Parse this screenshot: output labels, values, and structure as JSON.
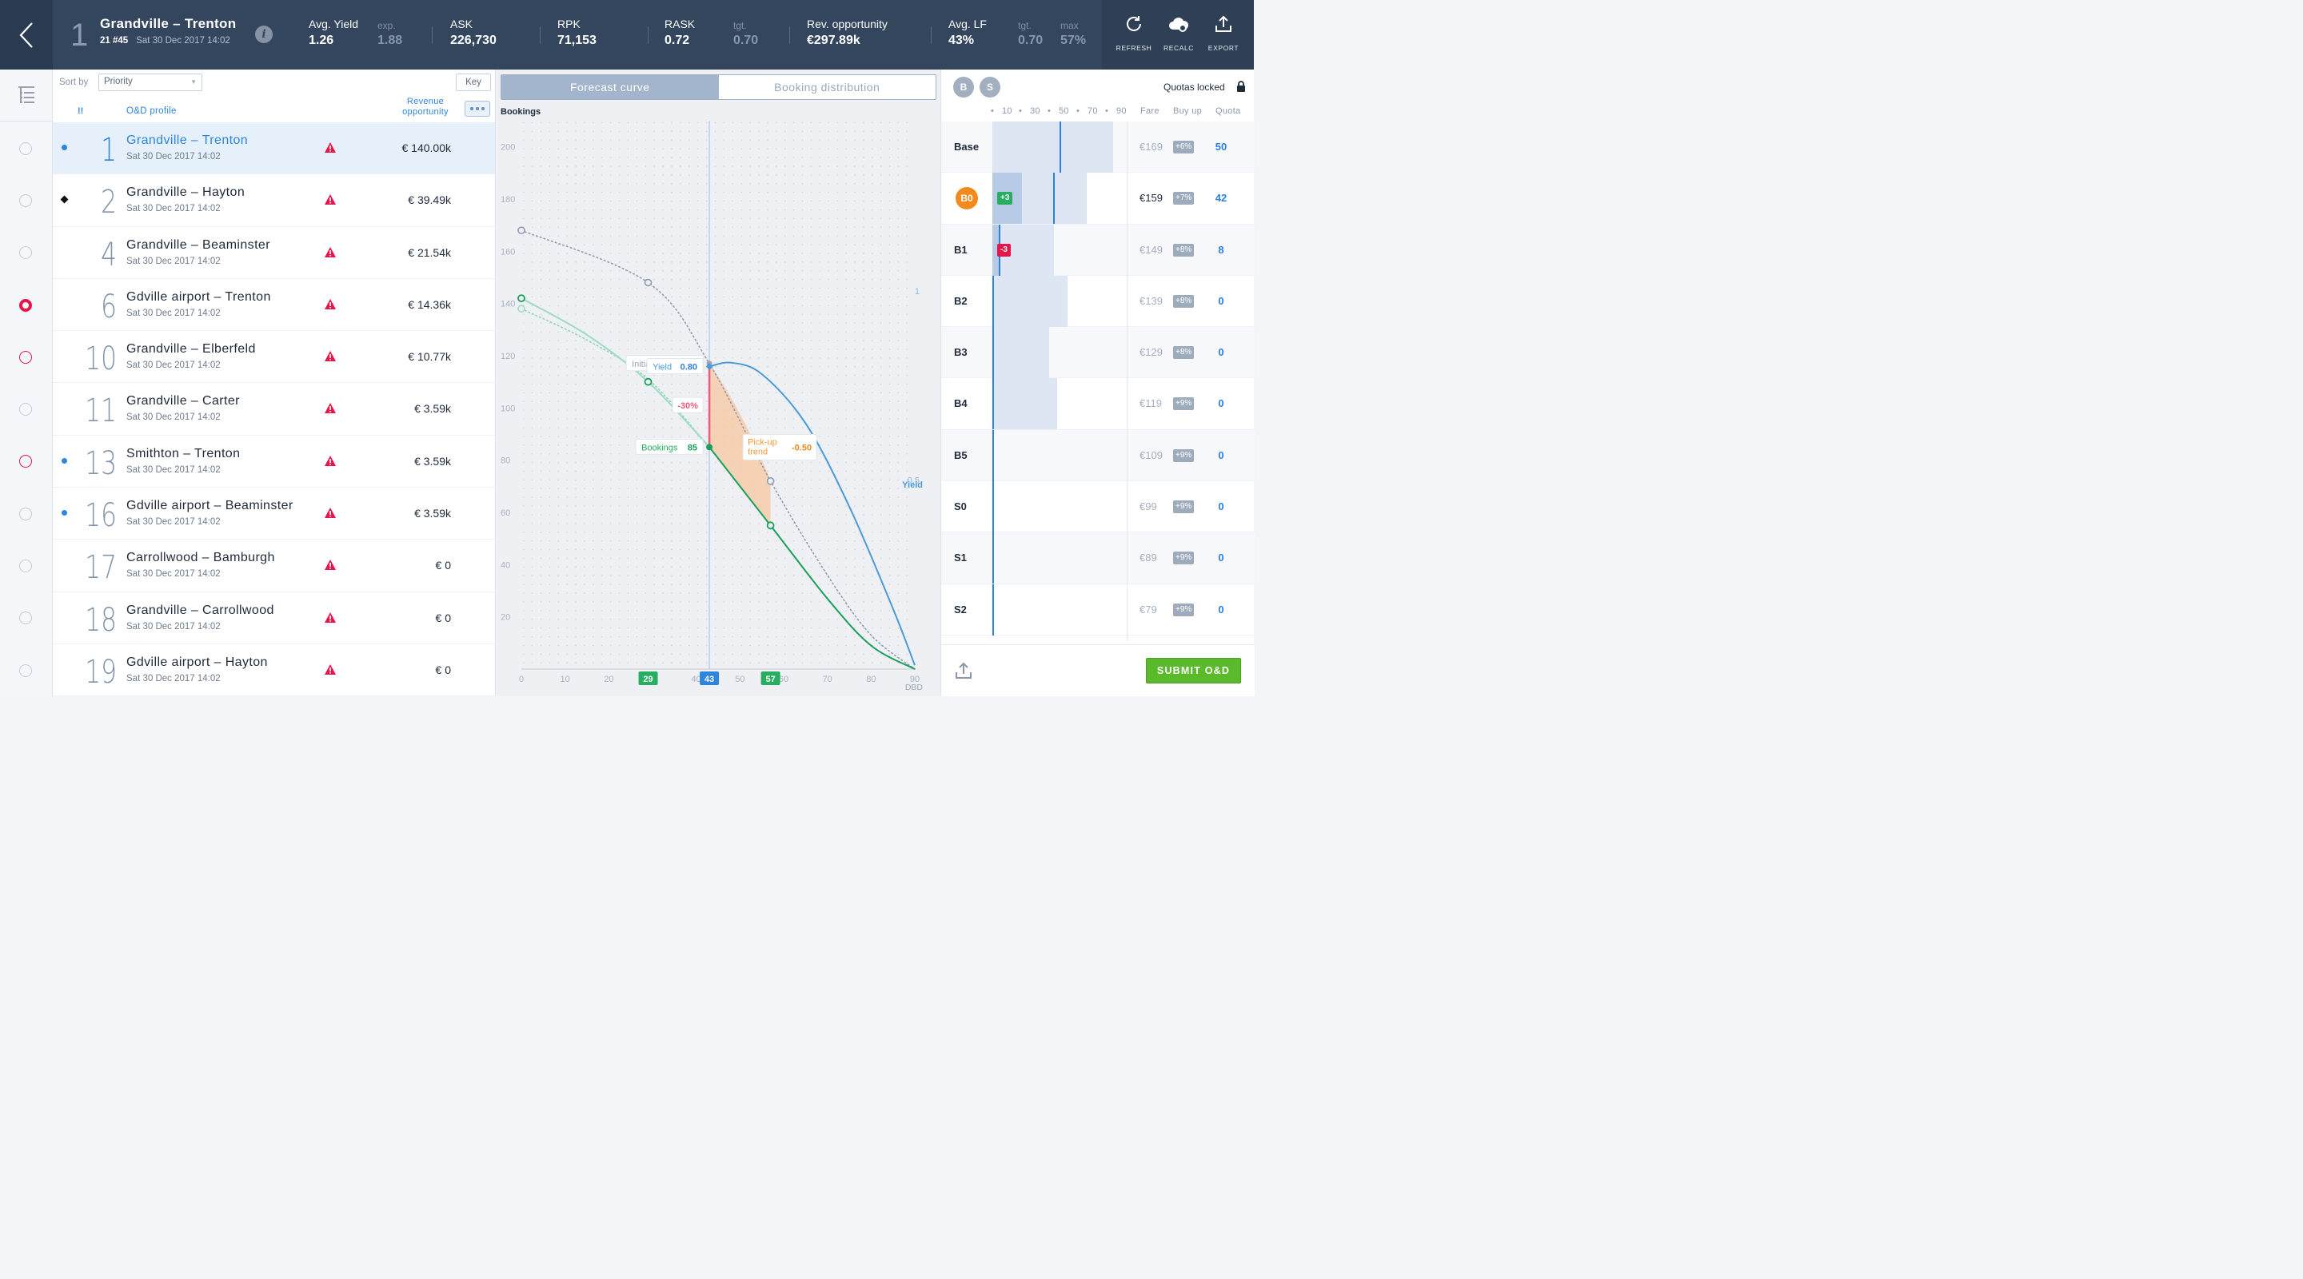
{
  "header": {
    "route_number": "1",
    "route_name": "Grandville – Trenton",
    "flight_code": "21 #45",
    "departure": "Sat 30 Dec 2017 14:02",
    "kpis": [
      {
        "label": "Avg. Yield",
        "value": "1.26",
        "sub_label": "exp.",
        "sub_value": "1.88"
      },
      {
        "label": "ASK",
        "value": "226,730"
      },
      {
        "label": "RPK",
        "value": "71,153"
      },
      {
        "label": "RASK",
        "value": "0.72",
        "sub_label": "tgt.",
        "sub_value": "0.70"
      },
      {
        "label": "Rev. opportunity",
        "value": "€297.89k"
      },
      {
        "label": "Avg. LF",
        "value": "43%",
        "sub_label": "tgt.",
        "sub_value": "0.70",
        "sub_label2": "max",
        "sub_value2": "57%"
      }
    ],
    "actions": [
      {
        "label": "REFRESH",
        "icon": "refresh-icon"
      },
      {
        "label": "RECALC",
        "icon": "cloud-gear-icon"
      },
      {
        "label": "EXPORT",
        "icon": "export-icon"
      }
    ]
  },
  "list": {
    "sort_by_label": "Sort by",
    "sort_by_value": "Priority",
    "key_label": "Key",
    "col_priority": "!!",
    "col_profile": "O&D profile",
    "col_revenue": "Revenue opportunity",
    "rows": [
      {
        "num": "1",
        "name": "Grandville – Trenton",
        "date": "Sat 30 Dec 2017 14:02",
        "rev": "€ 140.00k",
        "marker": "dot",
        "radio": "empty",
        "active": true
      },
      {
        "num": "2",
        "name": "Grandville – Hayton",
        "date": "Sat 30 Dec 2017 14:02",
        "rev": "€ 39.49k",
        "marker": "diamond",
        "radio": "empty"
      },
      {
        "num": "4",
        "name": "Grandville – Beaminster",
        "date": "Sat 30 Dec 2017 14:02",
        "rev": "€ 21.54k",
        "marker": "",
        "radio": "empty"
      },
      {
        "num": "6",
        "name": "Gdville airport – Trenton",
        "date": "Sat 30 Dec 2017 14:02",
        "rev": "€ 14.36k",
        "marker": "",
        "radio": "selected"
      },
      {
        "num": "10",
        "name": "Grandville – Elberfeld",
        "date": "Sat 30 Dec 2017 14:02",
        "rev": "€ 10.77k",
        "marker": "",
        "radio": "red"
      },
      {
        "num": "11",
        "name": "Grandville – Carter",
        "date": "Sat 30 Dec 2017 14:02",
        "rev": "€ 3.59k",
        "marker": "",
        "radio": "empty"
      },
      {
        "num": "13",
        "name": "Smithton – Trenton",
        "date": "Sat 30 Dec 2017 14:02",
        "rev": "€ 3.59k",
        "marker": "dot",
        "radio": "red"
      },
      {
        "num": "16",
        "name": "Gdville airport – Beaminster",
        "date": "Sat 30 Dec 2017 14:02",
        "rev": "€ 3.59k",
        "marker": "dot",
        "radio": "empty"
      },
      {
        "num": "17",
        "name": "Carrollwood – Bamburgh",
        "date": "Sat 30 Dec 2017 14:02",
        "rev": "€ 0",
        "marker": "",
        "radio": "empty"
      },
      {
        "num": "18",
        "name": "Grandville – Carrollwood",
        "date": "Sat 30 Dec 2017 14:02",
        "rev": "€ 0",
        "marker": "",
        "radio": "empty"
      },
      {
        "num": "19",
        "name": "Gdville airport – Hayton",
        "date": "Sat 30 Dec 2017 14:02",
        "rev": "€ 0",
        "marker": "",
        "radio": "empty"
      }
    ]
  },
  "chart_tabs": [
    {
      "label": "Forecast curve",
      "active": true
    },
    {
      "label": "Booking distribution",
      "active": false
    }
  ],
  "chart_data": {
    "type": "line",
    "ylabel": "Bookings",
    "xlabel": "DBD",
    "y2label": "Yield",
    "xlim": [
      0,
      90
    ],
    "ylim": [
      0,
      210
    ],
    "y2lim": [
      0,
      1.45
    ],
    "xticks": [
      0,
      10,
      20,
      30,
      40,
      50,
      60,
      70,
      80,
      90
    ],
    "yticks": [
      20,
      40,
      60,
      80,
      100,
      120,
      140,
      160,
      180,
      200
    ],
    "y2ticks": [
      0.5,
      1
    ],
    "current_dbd": 43,
    "x_markers": [
      {
        "value": 29,
        "color": "#27ae60"
      },
      {
        "value": 43,
        "color": "#2d86dd"
      },
      {
        "value": 57,
        "color": "#27ae60"
      }
    ],
    "series": [
      {
        "name": "Initial fcst",
        "style": "dotted",
        "color": "#8e9bb0",
        "x": [
          0,
          29,
          43,
          57,
          70,
          80,
          90
        ],
        "y": [
          168,
          148,
          117,
          72,
          36,
          13,
          0
        ],
        "points": [
          0,
          29,
          43,
          57
        ]
      },
      {
        "name": "Bookings",
        "style": "solid",
        "color": "#2fb36b",
        "x": [
          0,
          15,
          29,
          43
        ],
        "y": [
          142,
          128,
          110,
          85
        ],
        "points": [
          0,
          29,
          43
        ]
      },
      {
        "name": "Bookings forecast",
        "style": "solid",
        "color": "#1aa05a",
        "x": [
          43,
          57,
          70,
          80,
          90
        ],
        "y": [
          85,
          55,
          27,
          9,
          0
        ],
        "points": [
          57
        ]
      },
      {
        "name": "Alt forecast",
        "style": "dotted",
        "color": "#8fd4b3",
        "x": [
          0,
          15,
          29,
          43
        ],
        "y": [
          138,
          126,
          111,
          85
        ]
      },
      {
        "name": "Yield",
        "style": "solid",
        "color": "#4a9bd6",
        "axis": "y2",
        "x": [
          43,
          48,
          55,
          65,
          75,
          85,
          90
        ],
        "y2": [
          0.8,
          0.81,
          0.78,
          0.65,
          0.43,
          0.16,
          0.01
        ],
        "points": [
          43
        ]
      }
    ],
    "annotations": [
      {
        "label": "Initial fcst",
        "value": "117",
        "x": 43,
        "y": 117
      },
      {
        "label": "Bookings",
        "value": "85",
        "x": 43,
        "y": 85
      },
      {
        "label": "-30%",
        "x": 43,
        "y": 101
      },
      {
        "label": "Pick-up trend",
        "value": "-0.50",
        "x": 50,
        "y": 85
      },
      {
        "label": "Yield",
        "value": "0.80",
        "x": 43,
        "y2": 0.8
      }
    ]
  },
  "right": {
    "pills": [
      "B",
      "S"
    ],
    "quotas_locked": "Quotas locked",
    "scale_ticks": [
      "10",
      "30",
      "50",
      "70",
      "90"
    ],
    "col_fare": "Fare",
    "col_buyup": "Buy up",
    "col_quota": "Quota",
    "classes": [
      {
        "name": "Base",
        "fare": "€169",
        "buy_up": "+6%",
        "quota": "50",
        "bar": 0.9,
        "line": 0.5
      },
      {
        "name": "B0",
        "fare": "€159",
        "buy_up": "+7%",
        "quota": "42",
        "bar": 0.7,
        "line": 0.45,
        "bar2": 0.22,
        "delta": "+3",
        "delta_color": "green",
        "badge": true,
        "fare_dark": true
      },
      {
        "name": "B1",
        "fare": "€149",
        "buy_up": "+8%",
        "quota": "8",
        "bar": 0.46,
        "line": 0.05,
        "bar2": 0.05,
        "delta": "-3",
        "delta_color": "red"
      },
      {
        "name": "B2",
        "fare": "€139",
        "buy_up": "+8%",
        "quota": "0",
        "bar": 0.56,
        "line": 0.0
      },
      {
        "name": "B3",
        "fare": "€129",
        "buy_up": "+8%",
        "quota": "0",
        "bar": 0.42,
        "line": 0.0
      },
      {
        "name": "B4",
        "fare": "€119",
        "buy_up": "+9%",
        "quota": "0",
        "bar": 0.48,
        "line": 0.0
      },
      {
        "name": "B5",
        "fare": "€109",
        "buy_up": "+9%",
        "quota": "0",
        "bar": 0.0,
        "line": 0.0
      },
      {
        "name": "S0",
        "fare": "€99",
        "buy_up": "+9%",
        "quota": "0",
        "bar": 0.0,
        "line": 0.0
      },
      {
        "name": "S1",
        "fare": "€89",
        "buy_up": "+9%",
        "quota": "0",
        "bar": 0.0,
        "line": 0.0
      },
      {
        "name": "S2",
        "fare": "€79",
        "buy_up": "+9%",
        "quota": "0",
        "bar": 0.0,
        "line": 0.0
      }
    ],
    "submit_label": "SUBMIT O&D"
  }
}
